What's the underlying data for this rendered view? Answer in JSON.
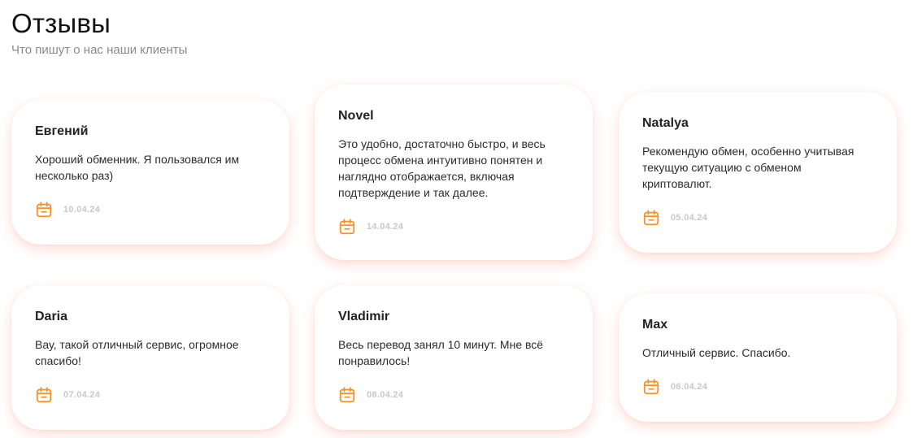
{
  "header": {
    "title": "Отзывы",
    "subtitle": "Что пишут о нас наши клиенты"
  },
  "accent_color": "#f7922a",
  "reviews": [
    {
      "name": "Евгений",
      "text": "Хороший обменник. Я пользовался им несколько раз)",
      "date": "10.04.24",
      "icon": "calendar-icon"
    },
    {
      "name": "Novel",
      "text": "Это удобно, достаточно быстро, и весь процесс обмена интуитивно понятен и наглядно отображается, включая подтверждение и так далее.",
      "date": "14.04.24",
      "icon": "calendar-icon"
    },
    {
      "name": "Natalya",
      "text": "Рекомендую обмен, особенно учитывая текущую ситуацию с обменом криптовалют.",
      "date": "05.04.24",
      "icon": "calendar-icon"
    },
    {
      "name": "Daria",
      "text": "Вау, такой отличный сервис, огромное спасибо!",
      "date": "07.04.24",
      "icon": "calendar-icon"
    },
    {
      "name": "Vladimir",
      "text": "Весь перевод занял 10 минут. Мне всё понравилось!",
      "date": "08.04.24",
      "icon": "calendar-icon"
    },
    {
      "name": "Max",
      "text": "Отличный сервис. Спасибо.",
      "date": "06.04.24",
      "icon": "calendar-icon"
    }
  ]
}
